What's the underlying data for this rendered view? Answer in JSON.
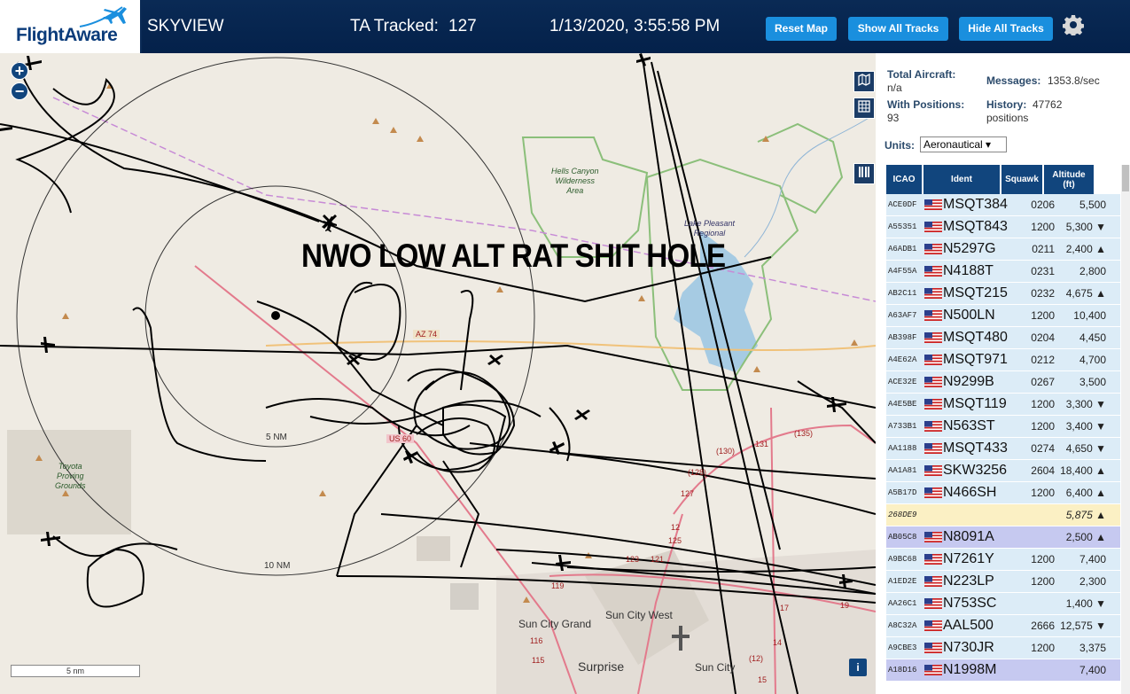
{
  "header": {
    "logo_text": "FlightAware",
    "app_title": "SKYVIEW",
    "tracked_label": "TA Tracked:",
    "tracked_value": "127",
    "timestamp": "1/13/2020, 3:55:58 PM",
    "buttons": {
      "reset": "Reset Map",
      "show_all": "Show All Tracks",
      "hide_all": "Hide All Tracks"
    },
    "settings_icon": "gear-icon"
  },
  "map": {
    "overlay_text": "NWO LOW ALT RAT SHIT HOLE",
    "range_rings": [
      "5 NM",
      "10 NM"
    ],
    "places": [
      "Sun City West",
      "Sun City Grand",
      "Surprise",
      "Sun City"
    ],
    "wilderness": [
      "Hells Canyon",
      "Wilderness",
      "Area"
    ],
    "lake": [
      "Lake Pleasant",
      "Regional"
    ],
    "proving_ground": [
      "Toyota",
      "Proving",
      "Grounds"
    ],
    "highways": [
      "AZ 74",
      "US 60"
    ],
    "road_numbers": [
      "(135)",
      "131",
      "(130)",
      "(128)",
      "127",
      "125",
      "123",
      "121",
      "119",
      "116",
      "115",
      "17",
      "14",
      "12",
      "(12)",
      "19",
      "15"
    ],
    "scale_label": "5 nm",
    "zoom": {
      "in": "+",
      "out": "−"
    },
    "info_label": "i",
    "colors": {
      "background": "#efebe3",
      "tracks": "#000000",
      "wilderness": "#8bbf7a",
      "lake": "#a6cbe3",
      "road_major": "#e37a8c",
      "road_minor": "#f0c27a"
    }
  },
  "panel": {
    "total_aircraft_label": "Total Aircraft:",
    "total_aircraft_value": "n/a",
    "with_positions_label": "With Positions:",
    "with_positions_value": "93",
    "messages_label": "Messages:",
    "messages_value": "1353.8/sec",
    "history_label": "History:",
    "history_value": "47762",
    "history_unit": "positions",
    "units_label": "Units:",
    "units_value": "Aeronautical ▾",
    "columns": {
      "icao": "ICAO",
      "ident": "Ident",
      "squawk": "Squawk",
      "altitude": "Altitude",
      "alt_unit": "(ft)"
    },
    "rows": [
      {
        "icao": "ACE0DF",
        "ident": "MSQT384",
        "squawk": "0206",
        "altitude": "5,500"
      },
      {
        "icao": "A55351",
        "ident": "MSQT843",
        "squawk": "1200",
        "altitude": "5,300 ▼"
      },
      {
        "icao": "A6ADB1",
        "ident": "N5297G",
        "squawk": "0211",
        "altitude": "2,400 ▲"
      },
      {
        "icao": "A4F55A",
        "ident": "N4188T",
        "squawk": "0231",
        "altitude": "2,800"
      },
      {
        "icao": "AB2C11",
        "ident": "MSQT215",
        "squawk": "0232",
        "altitude": "4,675 ▲"
      },
      {
        "icao": "A63AF7",
        "ident": "N500LN",
        "squawk": "1200",
        "altitude": "10,400"
      },
      {
        "icao": "AB398F",
        "ident": "MSQT480",
        "squawk": "0204",
        "altitude": "4,450"
      },
      {
        "icao": "A4E62A",
        "ident": "MSQT971",
        "squawk": "0212",
        "altitude": "4,700"
      },
      {
        "icao": "ACE32E",
        "ident": "N9299B",
        "squawk": "0267",
        "altitude": "3,500"
      },
      {
        "icao": "A4E5BE",
        "ident": "MSQT119",
        "squawk": "1200",
        "altitude": "3,300 ▼"
      },
      {
        "icao": "A733B1",
        "ident": "N563ST",
        "squawk": "1200",
        "altitude": "3,400 ▼"
      },
      {
        "icao": "AA1188",
        "ident": "MSQT433",
        "squawk": "0274",
        "altitude": "4,650 ▼"
      },
      {
        "icao": "AA1A81",
        "ident": "SKW3256",
        "squawk": "2604",
        "altitude": "18,400 ▲"
      },
      {
        "icao": "A5B17D",
        "ident": "N466SH",
        "squawk": "1200",
        "altitude": "6,400 ▲"
      },
      {
        "icao": "268DE9",
        "ident": "",
        "squawk": "",
        "altitude": "5,875 ▲",
        "nopos": true
      },
      {
        "icao": "AB05C8",
        "ident": "N8091A",
        "squawk": "",
        "altitude": "2,500 ▲",
        "selected": true
      },
      {
        "icao": "A9BC68",
        "ident": "N7261Y",
        "squawk": "1200",
        "altitude": "7,400"
      },
      {
        "icao": "A1ED2E",
        "ident": "N223LP",
        "squawk": "1200",
        "altitude": "2,300"
      },
      {
        "icao": "AA26C1",
        "ident": "N753SC",
        "squawk": "",
        "altitude": "1,400 ▼"
      },
      {
        "icao": "A8C32A",
        "ident": "AAL500",
        "squawk": "2666",
        "altitude": "12,575 ▼"
      },
      {
        "icao": "A9CBE3",
        "ident": "N730JR",
        "squawk": "1200",
        "altitude": "3,375"
      },
      {
        "icao": "A18D16",
        "ident": "N1998M",
        "squawk": "",
        "altitude": "7,400",
        "selected": true
      }
    ]
  }
}
